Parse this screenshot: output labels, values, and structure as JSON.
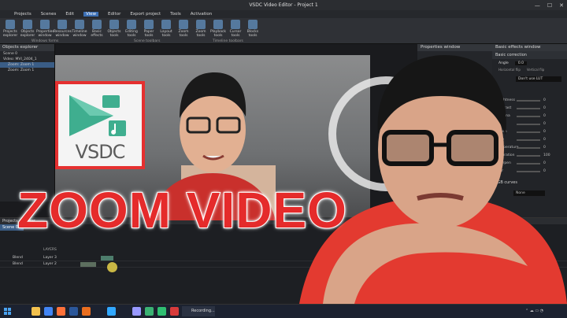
{
  "window": {
    "title": "VSDC Video Editor - Project 1",
    "controls": [
      "—",
      "☐",
      "✕"
    ]
  },
  "menu": {
    "items": [
      "Projects",
      "Scenes",
      "Edit",
      "View",
      "Editor",
      "Export project",
      "Tools",
      "Activation"
    ],
    "active": "View"
  },
  "ribbon": {
    "buttons": [
      "Projects explorer",
      "Objects explorer",
      "Properties window",
      "Resources window",
      "Timeline window",
      "Basic effects",
      "Objects tools",
      "Editing tools",
      "Paper tools",
      "Layout tools",
      "Zoom tools",
      "Zoom tools",
      "Playback tools",
      "Cursor tools",
      "Blocks tools"
    ],
    "groups": [
      "Windows forms",
      "Scene toolbars",
      "Timeline toolbars"
    ]
  },
  "objects_explorer": {
    "title": "Objects explorer",
    "tree": [
      "Scene 0",
      "Video: MVI_2404_1",
      "Zoom: Zoom 1",
      "Zoom: Zoom 1"
    ]
  },
  "properties_window": {
    "title": "Properties window"
  },
  "effects_window": {
    "title": "Basic effects window",
    "section": "Basic correction",
    "angle_label": "Angle",
    "angle_value": "0.0",
    "flip": [
      "Horizontal flip",
      "Vertical flip"
    ],
    "lut_value": "Don't use LUT",
    "rows": [
      {
        "label": "Brightness",
        "value": "0"
      },
      {
        "label": "Contrast",
        "value": "0"
      },
      {
        "label": "Gamma",
        "value": "0"
      },
      {
        "label": "Red",
        "value": "0"
      },
      {
        "label": "Green",
        "value": "0"
      },
      {
        "label": "Blue",
        "value": "0"
      },
      {
        "label": "Temperature",
        "value": "0"
      },
      {
        "label": "Saturation",
        "value": "100"
      },
      {
        "label": "Sharpen",
        "value": "0"
      },
      {
        "label": "Blur",
        "value": "0"
      }
    ],
    "curves": "RGB curves",
    "curves_mode": "None"
  },
  "timeline": {
    "header": "Projects explorer",
    "scene_tab": "Scene 0",
    "column": "LAYERS",
    "tracks": [
      {
        "blend": "Blend",
        "layer": "Layer 3"
      },
      {
        "blend": "Blend",
        "layer": "Layer 2"
      }
    ]
  },
  "thumbnail": {
    "logo_text": "VSDC",
    "headline": "ZOOM VIDEO",
    "headline_color": "#e52b2b",
    "logo_border_color": "#e53030"
  },
  "taskbar": {
    "recording_label": "Recording...",
    "app_icons": [
      "file-explorer-icon",
      "chrome-icon",
      "firefox-icon",
      "word-icon",
      "photoshop-icon",
      "premiere-icon",
      "vsdc-icon",
      "camtasia-icon",
      "teams-icon",
      "recorder-icon"
    ]
  }
}
